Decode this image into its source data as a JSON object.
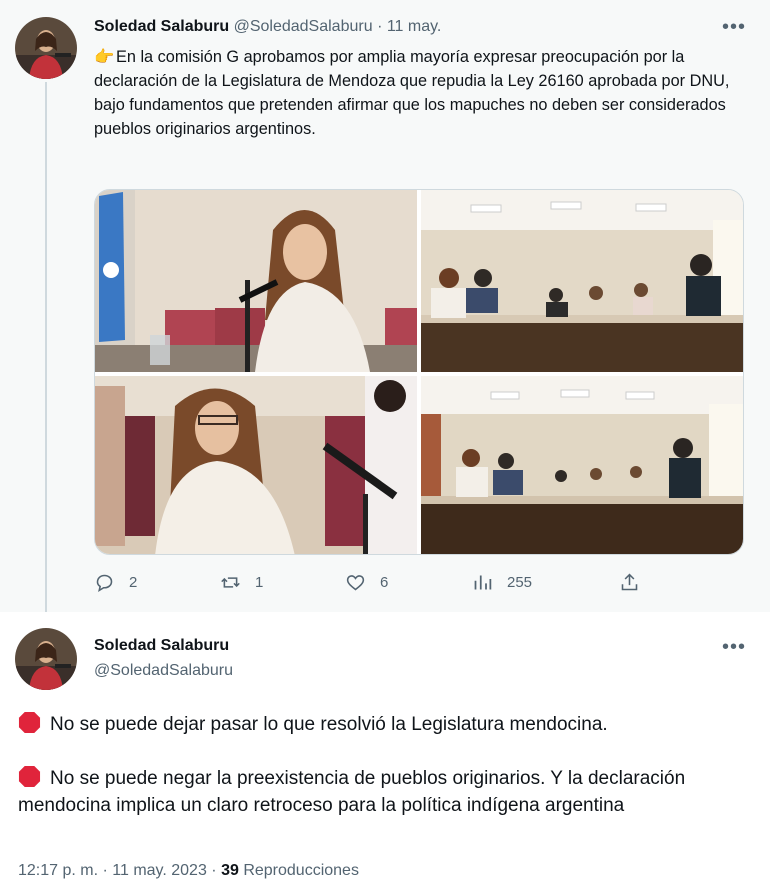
{
  "tweet1": {
    "author_name": "Soledad Salaburu",
    "author_handle": "@SoledadSalaburu",
    "date": "· 11 may.",
    "text": "En la comisión G aprobamos por amplia mayoría expresar preocupación por la declaración de la Legislatura de Mendoza que repudia la Ley 26160 aprobada por DNU, bajo fundamentos que pretenden afirmar que los mapuches no deben ser considerados pueblos originarios argentinos.",
    "emoji": "👉",
    "replies": "2",
    "retweets": "1",
    "likes": "6",
    "views": "255"
  },
  "tweet2": {
    "author_name": "Soledad Salaburu",
    "author_handle": "@SoledadSalaburu",
    "paragraph1": "No se puede dejar pasar lo que resolvió la Legislatura mendocina.",
    "paragraph2": "No se puede negar la preexistencia de pueblos originarios. Y la declaración mendocina implica un claro retroceso para la política indígena argentina",
    "time": "12:17 p. m. · 11 may. 2023 ·",
    "views_count": "39",
    "views_label": "Reproducciones"
  },
  "icons": {
    "reply": "reply-icon",
    "retweet": "retweet-icon",
    "like": "like-icon",
    "views": "views-icon",
    "share": "share-icon",
    "more": "more-icon",
    "stop": "stop-sign-icon"
  },
  "colors": {
    "text": "#0f1419",
    "secondary": "#536471",
    "stop_red": "#e0243b",
    "highlight_bg": "#f7f9f9"
  }
}
